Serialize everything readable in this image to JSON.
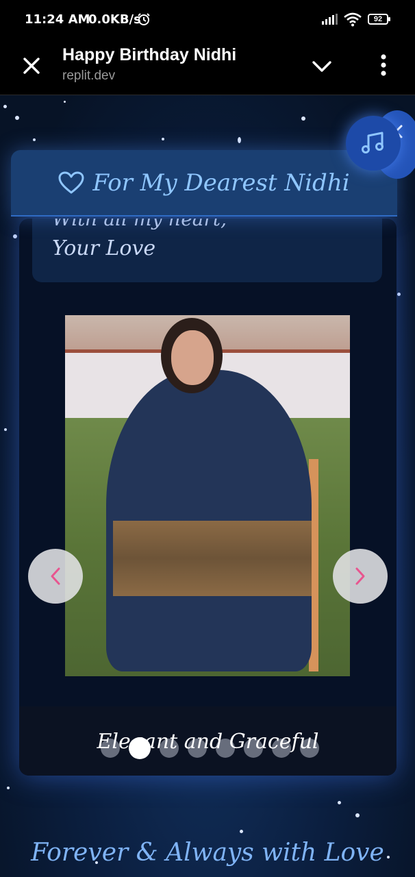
{
  "status_bar": {
    "time": "11:24 AM",
    "network_speed": "0.0KB/s",
    "battery": "92"
  },
  "browser": {
    "title": "Happy Birthday Nidhi",
    "url": "replit.dev"
  },
  "page": {
    "header_title": "For My Dearest Nidhi",
    "letter_partial_line": "With all my heart,",
    "letter_signature": "Your Love",
    "photo_caption": "Elegant and Graceful",
    "slide_count": 8,
    "active_slide": 2,
    "footer_text": "Forever & Always with Love"
  },
  "colors": {
    "accent_pink": "#e8558f",
    "header_text": "#8fc6ff",
    "music_button": "#1d4aa8"
  }
}
